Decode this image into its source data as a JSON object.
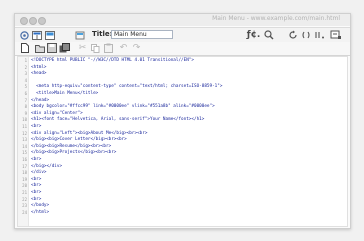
{
  "window": {
    "title": "Main Menu - www.example.com/main.html"
  },
  "toolbar": {
    "title_label": "Title:",
    "title_value": "Main Menu",
    "icons": [
      "code-view-icon",
      "split-view-icon",
      "design-view-icon",
      "title-label",
      "validate-icon",
      "browser-preview-icon",
      "refresh-icon",
      "options-icon",
      "file-management-icon"
    ]
  },
  "toolbar2": {
    "icons": [
      "new-document-icon",
      "open-icon",
      "save-icon",
      "save-all-icon",
      "cut-icon",
      "copy-icon",
      "paste-icon",
      "undo-icon",
      "redo-icon"
    ]
  },
  "colors": {
    "code_text": "#17249a",
    "gutter_bg": "#f4f4f4"
  },
  "code": {
    "lines": [
      {
        "num": "1",
        "text": "<!DOCTYPE html PUBLIC \"-//W3C//DTD HTML 4.01 Transitional//EN\">"
      },
      {
        "num": "2",
        "text": "<html>"
      },
      {
        "num": "3",
        "text": "<head>"
      },
      {
        "num": "4",
        "text": ""
      },
      {
        "num": "5",
        "text": "  <meta http-equiv=\"content-type\" content=\"text/html; charset=ISO-8859-1\">"
      },
      {
        "num": "6",
        "text": "  <title>Main Menu</title>"
      },
      {
        "num": "7",
        "text": "</head>"
      },
      {
        "num": "8",
        "text": "<body bgcolor=\"#ffcc99\" link=\"#0000ee\" vlink=\"#551a8b\" alink=\"#0000ee\">"
      },
      {
        "num": "9",
        "text": "<div align=\"Center\">"
      },
      {
        "num": "10",
        "text": "<h1><font face=\"Helvetica, Arial, sans-serif\">Your Name</font></h1>"
      },
      {
        "num": "11",
        "text": "<br>"
      },
      {
        "num": "12",
        "text": "<div align=\"Left\"><big>About Me</big><br><br>"
      },
      {
        "num": "13",
        "text": "</big><big>Cover Letter</big><br><br>"
      },
      {
        "num": "14",
        "text": "</big><big>Resume</big><br><br>"
      },
      {
        "num": "15",
        "text": "</big><big>Projects</big><br><br>"
      },
      {
        "num": "16",
        "text": "<br>"
      },
      {
        "num": "17",
        "text": "</big></div>"
      },
      {
        "num": "18",
        "text": "</div>"
      },
      {
        "num": "19",
        "text": "<br>"
      },
      {
        "num": "20",
        "text": "<br>"
      },
      {
        "num": "21",
        "text": "<br>"
      },
      {
        "num": "22",
        "text": "<br>"
      },
      {
        "num": "23",
        "text": "</body>"
      },
      {
        "num": "24",
        "text": "</html>"
      }
    ]
  }
}
